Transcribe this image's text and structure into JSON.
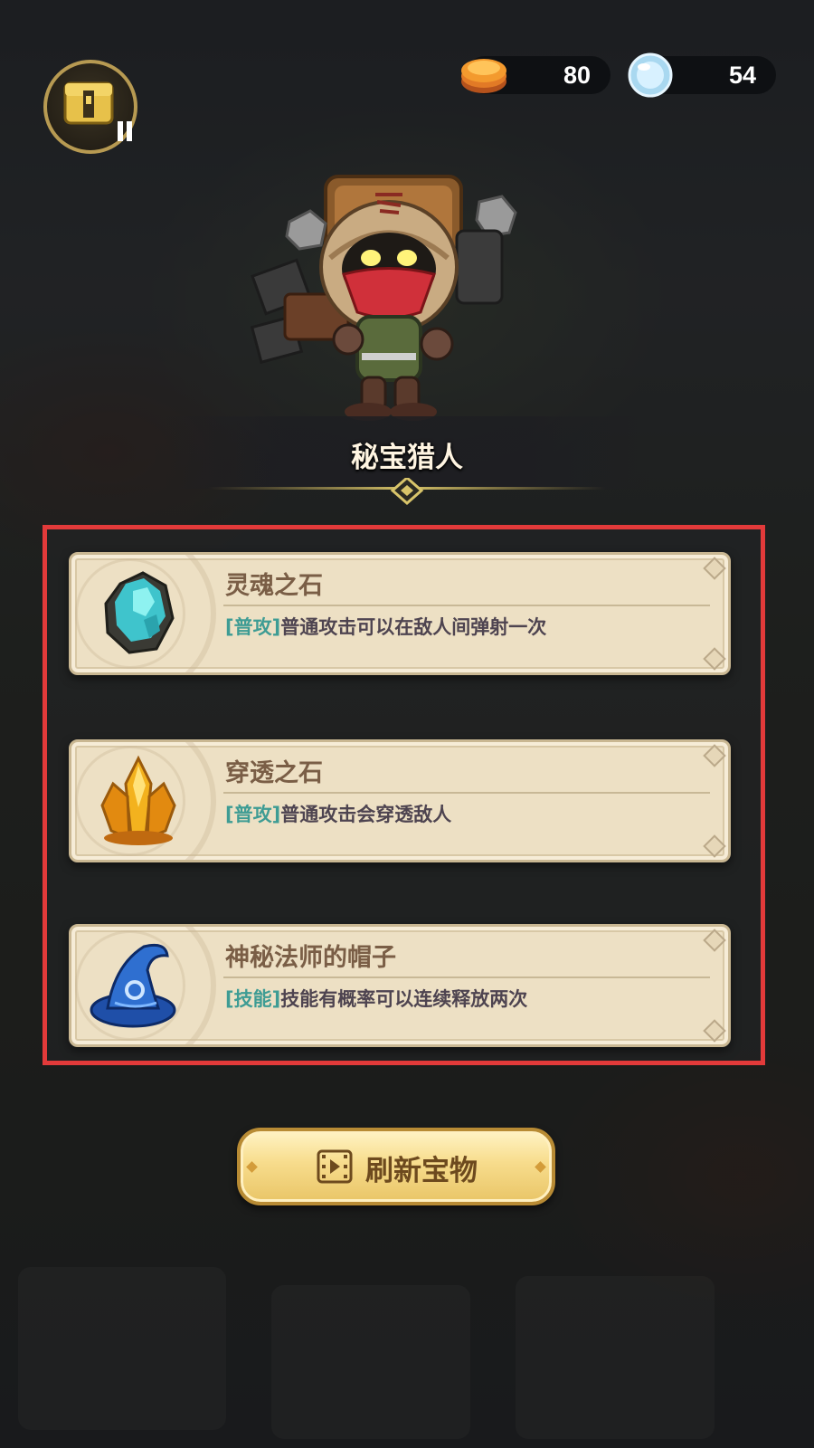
{
  "hud": {
    "chest_icon": "treasure-chest-pause-icon",
    "currencies": [
      {
        "icon": "gold-coin-icon",
        "value": "80"
      },
      {
        "icon": "diamond-gem-icon",
        "value": "54"
      }
    ]
  },
  "hero": {
    "name": "秘宝猎人",
    "icon": "hooded-hunter-character"
  },
  "treasures": [
    {
      "icon": "soul-stone-icon",
      "title": "灵魂之石",
      "tag": "[普攻]",
      "description": "普通攻击可以在敌人间弹射一次"
    },
    {
      "icon": "pierce-stone-icon",
      "title": "穿透之石",
      "tag": "[普攻]",
      "description": "普通攻击会穿透敌人"
    },
    {
      "icon": "wizard-hat-icon",
      "title": "神秘法师的帽子",
      "tag": "[技能]",
      "description": "技能有概率可以连续释放两次"
    }
  ],
  "refresh_button": {
    "icon": "video-play-icon",
    "label": "刷新宝物"
  },
  "colors": {
    "highlight_frame": "#e23a3a",
    "card_background": "#ede0c4",
    "tag_text": "#3e9c94",
    "title_text": "#7a5e46",
    "button_gold": "#f7dc8c"
  }
}
